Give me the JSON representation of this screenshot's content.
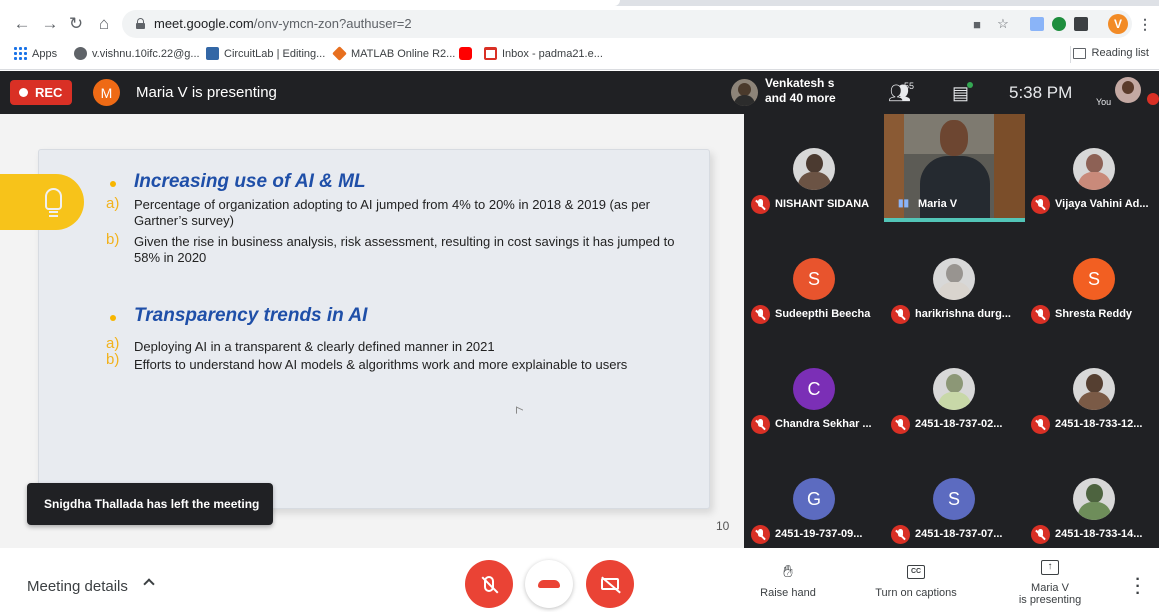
{
  "browser": {
    "url_host": "meet.google.com",
    "url_path": "/onv-ymcn-zon?authuser=2",
    "profile_initial": "V",
    "bookmarks": [
      {
        "label": "Apps",
        "icon": "apps-grid-icon"
      },
      {
        "label": "v.vishnu.10ifc.22@g...",
        "icon": "globe-icon"
      },
      {
        "label": "CircuitLab | Editing...",
        "icon": "circuitlab-icon"
      },
      {
        "label": "MATLAB Online R2...",
        "icon": "matlab-icon"
      },
      {
        "label": "",
        "icon": "youtube-icon"
      },
      {
        "label": "Inbox - padma21.e...",
        "icon": "gmail-icon"
      }
    ],
    "reading_list": "Reading list"
  },
  "meet_header": {
    "rec_label": "REC",
    "presenter_initial": "M",
    "presenting_text": "Maria V is presenting",
    "people_line1": "Venkatesh s",
    "people_line2": "and 40 more",
    "participant_count": "55",
    "time": "5:38 PM",
    "you_label": "You"
  },
  "slide": {
    "sections": [
      {
        "heading": "Increasing use of AI & ML",
        "items": [
          {
            "letter": "a)",
            "text": "Percentage of organization adopting to AI jumped from 4% to 20% in 2018 & 2019 (as per Gartner’s survey)"
          },
          {
            "letter": "b)",
            "text": "Given the rise in business analysis, risk assessment, resulting in cost savings it has jumped to 58% in 2020"
          }
        ]
      },
      {
        "heading": "Transparency trends in AI",
        "items": [
          {
            "letter": "a)",
            "text": "Deploying AI in a transparent & clearly defined manner in 2021"
          },
          {
            "letter": "b)",
            "text": "Efforts to understand how AI models & algorithms work and more explainable to users"
          }
        ]
      }
    ],
    "slide_number": "10"
  },
  "toast": "Snigdha Thallada has left the meeting",
  "participants": [
    {
      "name": "NISHANT SIDANA",
      "type": "photo",
      "color": "#6b5344"
    },
    {
      "name": "Maria V",
      "type": "video"
    },
    {
      "name": "Vijaya Vahini Ad...",
      "type": "photo",
      "color": "#c98a7a"
    },
    {
      "name": "Sudeepthi Beecha",
      "type": "initial",
      "initial": "S",
      "color": "#e8542d"
    },
    {
      "name": "harikrishna durg...",
      "type": "photo",
      "color": "#d9d4ce"
    },
    {
      "name": "Shresta Reddy",
      "type": "initial",
      "initial": "S",
      "color": "#f25f22"
    },
    {
      "name": "Chandra Sekhar ...",
      "type": "initial",
      "initial": "C",
      "color": "#7b2fb6"
    },
    {
      "name": "2451-18-737-02...",
      "type": "photo",
      "color": "#c8d8a8"
    },
    {
      "name": "2451-18-733-12...",
      "type": "photo",
      "color": "#7a5a46"
    },
    {
      "name": "2451-19-737-09...",
      "type": "initial",
      "initial": "G",
      "color": "#5c6bc0"
    },
    {
      "name": "2451-18-737-07...",
      "type": "initial",
      "initial": "S",
      "color": "#5c6bc0"
    },
    {
      "name": "2451-18-733-14...",
      "type": "photo",
      "color": "#6e8d5a"
    }
  ],
  "bottom_bar": {
    "meeting_details": "Meeting details",
    "raise_hand": "Raise hand",
    "captions": "Turn on captions",
    "captions_icon_text": "CC",
    "presenting_line1": "Maria V",
    "presenting_line2": "is presenting"
  },
  "colors": {
    "meet_dark": "#202124",
    "danger_red": "#ea4335",
    "slide_heading_blue": "#1f4fa8",
    "slide_accent_yellow": "#f7c31a"
  }
}
